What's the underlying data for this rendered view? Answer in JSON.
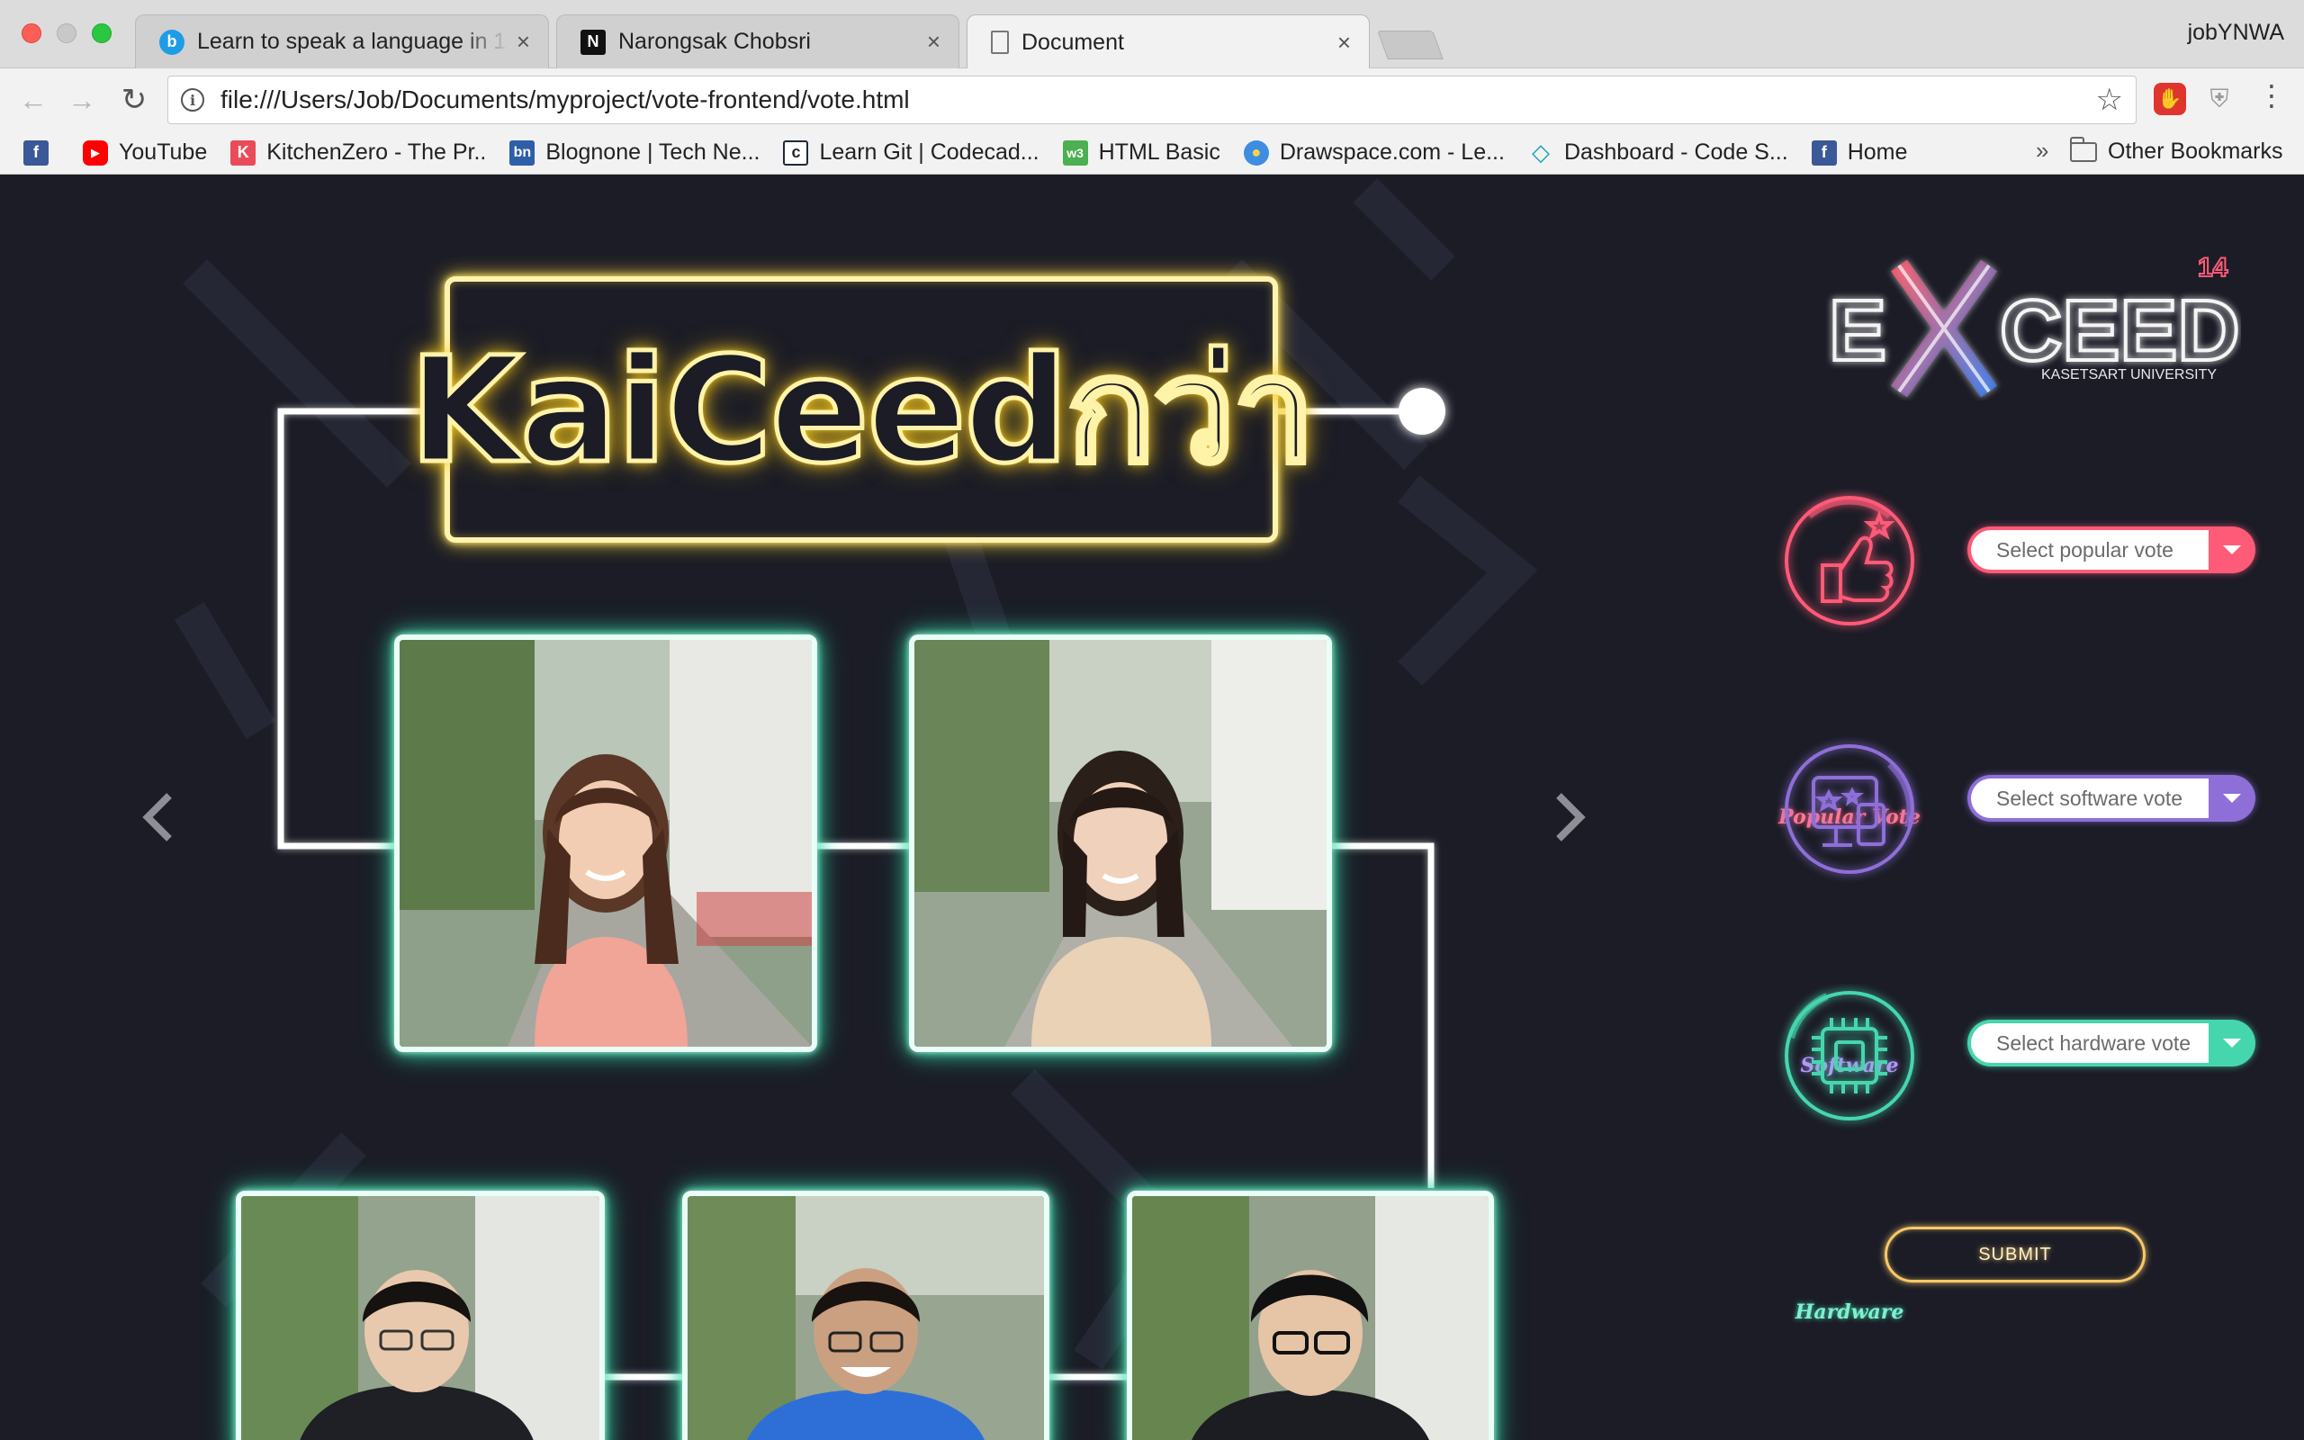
{
  "browser": {
    "tabs": [
      {
        "title": "Learn to speak a language in 10",
        "favicon": "b"
      },
      {
        "title": "Narongsak Chobsri",
        "favicon": "N"
      },
      {
        "title": "Document",
        "favicon": "doc"
      }
    ],
    "close_glyph": "×",
    "profile_name": "jobYNWA",
    "url": "file:///Users/Job/Documents/myproject/vote-frontend/vote.html",
    "bookmarks": [
      {
        "label": "",
        "icon": "facebook-icon",
        "color": "#3b5998",
        "glyph": "f"
      },
      {
        "label": "YouTube",
        "icon": "youtube-icon",
        "color": "#ff0000",
        "glyph": "▶"
      },
      {
        "label": "KitchenZero - The Pr..",
        "icon": "kitchenzero-icon",
        "color": "#e94b5a",
        "glyph": "K"
      },
      {
        "label": "Blognone | Tech Ne...",
        "icon": "blognone-icon",
        "color": "#2f5fa8",
        "glyph": "bn"
      },
      {
        "label": "Learn Git | Codecad...",
        "icon": "codecademy-icon",
        "color": "#1f2a36",
        "glyph": "c"
      },
      {
        "label": "HTML Basic",
        "icon": "w3schools-icon",
        "color": "#4caf50",
        "glyph": "w3"
      },
      {
        "label": "Drawspace.com - Le...",
        "icon": "drawspace-icon",
        "color": "#3d8de0",
        "glyph": "●"
      },
      {
        "label": "Dashboard - Code S...",
        "icon": "codeschool-icon",
        "color": "#17a2b8",
        "glyph": "◇"
      },
      {
        "label": "Home",
        "icon": "facebook-icon",
        "color": "#3b5998",
        "glyph": "f"
      }
    ],
    "more_bookmarks": "»",
    "other_bookmarks": "Other Bookmarks"
  },
  "page": {
    "title": "KaiCeedกว่า",
    "popular": {
      "placeholder": "Select popular vote",
      "caption": "Popular Vote",
      "color": "#ff5a78"
    },
    "software": {
      "placeholder": "Select software vote",
      "caption": "Software",
      "color": "#8e6fd8"
    },
    "hardware": {
      "placeholder": "Select hardware vote",
      "caption": "Hardware",
      "color": "#46d6ad"
    },
    "submit_label": "SUBMIT",
    "logo": {
      "text": "EXCEED",
      "sub": "KASETSART UNIVERSITY",
      "edition": "14"
    }
  }
}
